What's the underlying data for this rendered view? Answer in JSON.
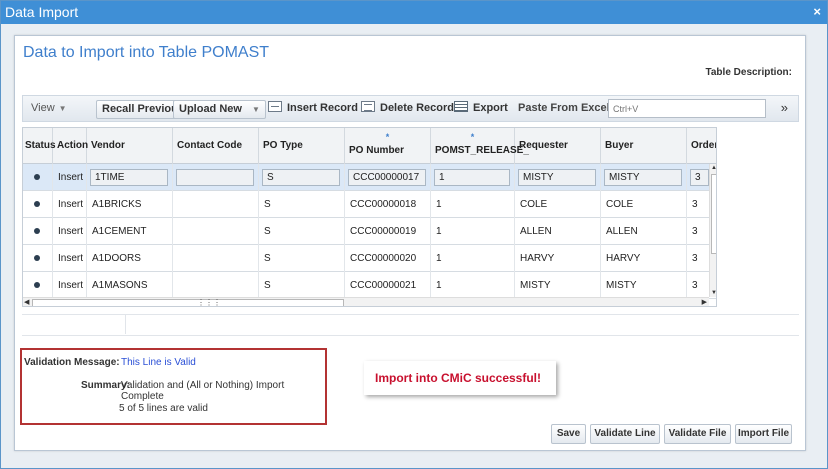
{
  "window": {
    "title": "Data Import",
    "close_glyph": "×"
  },
  "panel": {
    "heading": "Data to Import into Table POMAST",
    "table_description": "Table Description:"
  },
  "toolbar": {
    "view": "View",
    "recall_previous": "Recall Previous",
    "upload_new": "Upload New",
    "insert_record": "Insert Record",
    "delete_record": "Delete Record",
    "export": "Export",
    "paste_from_excel": "Paste From Excel",
    "paste_placeholder": "Ctrl+V",
    "overflow": "»"
  },
  "grid": {
    "columns": [
      "Status",
      "Action",
      "Vendor",
      "Contact Code",
      "PO Type",
      "PO Number",
      "POMST_RELEASE_",
      "Requester",
      "Buyer",
      "Order"
    ],
    "required_marker": "*",
    "rows": [
      {
        "action": "Insert",
        "vendor": "1TIME",
        "contact": "",
        "po_type": "S",
        "po_number": "CCC00000017",
        "release": "1",
        "requester": "MISTY",
        "buyer": "MISTY",
        "order": "3"
      },
      {
        "action": "Insert",
        "vendor": "A1BRICKS",
        "contact": "",
        "po_type": "S",
        "po_number": "CCC00000018",
        "release": "1",
        "requester": "COLE",
        "buyer": "COLE",
        "order": "3"
      },
      {
        "action": "Insert",
        "vendor": "A1CEMENT",
        "contact": "",
        "po_type": "S",
        "po_number": "CCC00000019",
        "release": "1",
        "requester": "ALLEN",
        "buyer": "ALLEN",
        "order": "3"
      },
      {
        "action": "Insert",
        "vendor": "A1DOORS",
        "contact": "",
        "po_type": "S",
        "po_number": "CCC00000020",
        "release": "1",
        "requester": "HARVY",
        "buyer": "HARVY",
        "order": "3"
      },
      {
        "action": "Insert",
        "vendor": "A1MASONS",
        "contact": "",
        "po_type": "S",
        "po_number": "CCC00000021",
        "release": "1",
        "requester": "MISTY",
        "buyer": "MISTY",
        "order": "3"
      }
    ]
  },
  "validation": {
    "message_label": "Validation Message:",
    "message": "This Line is Valid",
    "summary_label": "Summary:",
    "summary": "Validation and (All or Nothing) Import Complete",
    "count": "5 of 5 lines are valid"
  },
  "callout": {
    "text": "Import into CMiC successful!"
  },
  "actions": {
    "save": "Save",
    "validate_line": "Validate Line",
    "validate_file": "Validate File",
    "import_file": "Import File"
  },
  "colors": {
    "titlebar": "#3f8fd6",
    "heading": "#3f7fcc",
    "success": "#c8102e",
    "highlight_border": "#b33333",
    "valid_message": "#2a4fd6"
  }
}
